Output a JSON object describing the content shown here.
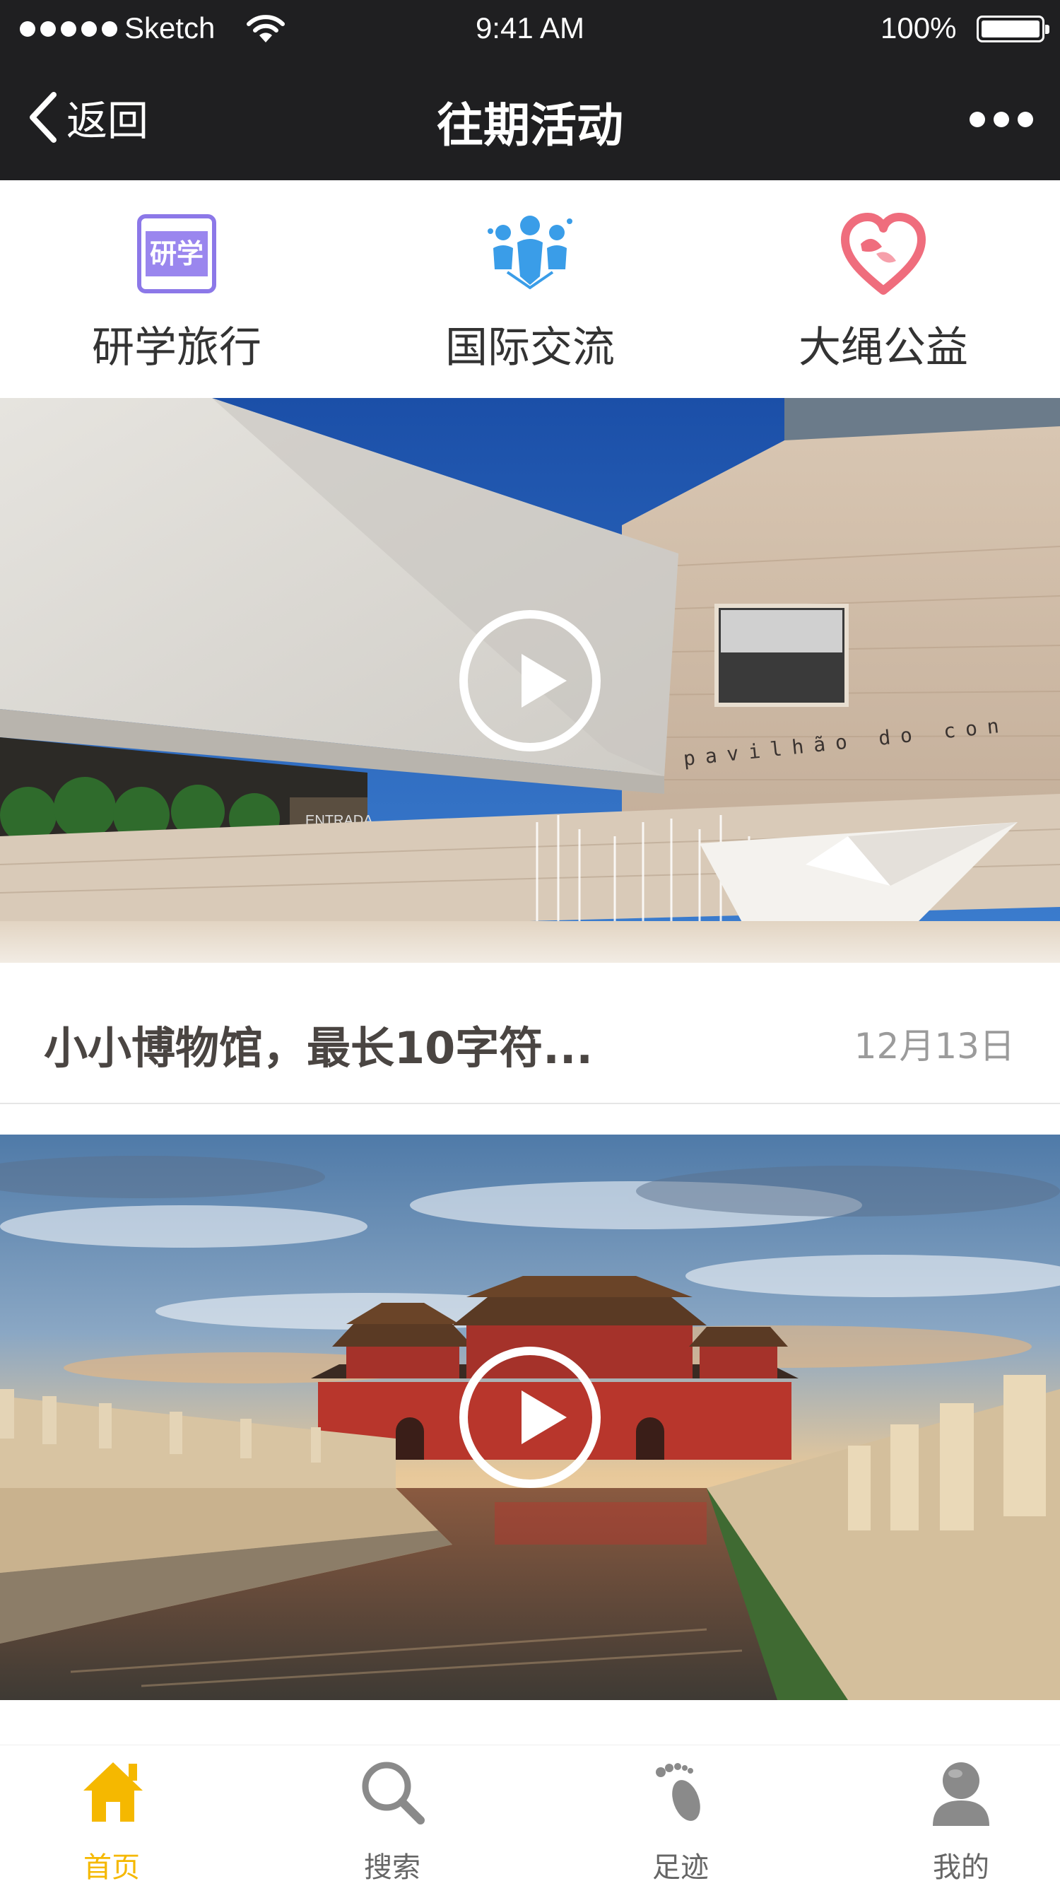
{
  "status_bar": {
    "carrier": "Sketch",
    "time": "9:41 AM",
    "battery": "100%"
  },
  "nav": {
    "back_label": "返回",
    "title": "往期活动"
  },
  "categories": [
    {
      "label": "研学旅行",
      "icon": "yanxue-icon",
      "icon_text": "研学"
    },
    {
      "label": "国际交流",
      "icon": "people-exchange-icon"
    },
    {
      "label": "大绳公益",
      "icon": "heart-icon"
    }
  ],
  "activities": [
    {
      "title": "小小博物馆，最长10字符...",
      "date": "12月13日",
      "image": "museum-photo",
      "image_text": {
        "sign": "pavilhão do con",
        "entrance": "ENTRADA"
      }
    },
    {
      "title": "",
      "date": "",
      "image": "forbidden-city-photo"
    }
  ],
  "tabbar": {
    "active_color": "#f5b800",
    "inactive_color": "#666666",
    "items": [
      {
        "label": "首页",
        "icon": "home-icon",
        "active": true
      },
      {
        "label": "搜索",
        "icon": "search-icon",
        "active": false
      },
      {
        "label": "足迹",
        "icon": "footprint-icon",
        "active": false
      },
      {
        "label": "我的",
        "icon": "profile-icon",
        "active": false
      }
    ]
  }
}
